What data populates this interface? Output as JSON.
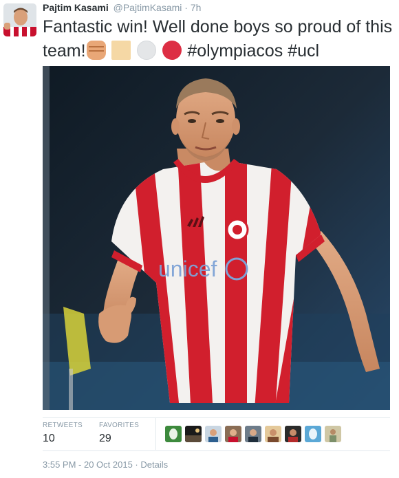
{
  "tweet": {
    "fullname": "Pajtim Kasami",
    "username": "@PajtimKasami",
    "separator": "·",
    "time": "7h",
    "text_part1": "Fantastic win! Well done boys so proud of this team!",
    "hashtag1": "#olympiacos",
    "hashtag2": "#ucl",
    "emojis": [
      "fist-emoji",
      "square-emoji",
      "white-circle-emoji",
      "red-circle-emoji"
    ]
  },
  "media": {
    "shirt_brand_text": "unicef",
    "colors": {
      "stripe_red": "#d11f2d",
      "shirt_white": "#f3f1ef",
      "bg_dark": "#1b2430"
    }
  },
  "stats": {
    "retweets_label": "RETWEETS",
    "retweets_count": "10",
    "favorites_label": "FAVORITES",
    "favorites_count": "29"
  },
  "favoriters": [
    "favoriter-avatar-1",
    "favoriter-avatar-2",
    "favoriter-avatar-3",
    "favoriter-avatar-4",
    "favoriter-avatar-5",
    "favoriter-avatar-6",
    "favoriter-avatar-7",
    "favoriter-avatar-8",
    "favoriter-avatar-9"
  ],
  "footer": {
    "timestamp": "3:55 PM - 20 Oct 2015",
    "separator": "·",
    "details_label": "Details"
  },
  "colors": {
    "secondary_text": "#8899a6",
    "primary_text": "#292f33",
    "divider": "#e1e8ed"
  }
}
